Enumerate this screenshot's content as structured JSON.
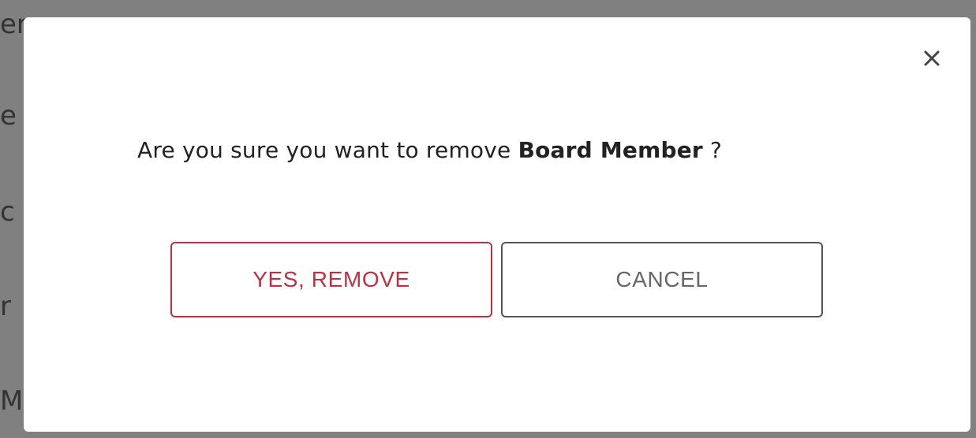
{
  "backdrop": {
    "fragments": [
      "er",
      "e",
      "c",
      "r",
      "M"
    ]
  },
  "dialog": {
    "close_icon": "close-icon",
    "message_prefix": "Are you sure you want to remove ",
    "message_entity": "Board Member",
    "message_suffix": " ?",
    "confirm_label": "YES, REMOVE",
    "cancel_label": "CANCEL"
  },
  "colors": {
    "overlay": "#808080",
    "danger": "#c0303f",
    "neutral_border": "#555555",
    "neutral_text": "#666666"
  }
}
